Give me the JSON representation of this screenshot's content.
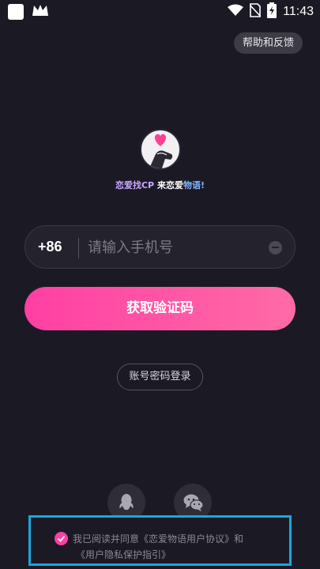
{
  "status_bar": {
    "time": "11:43",
    "icons": [
      "app-square-icon",
      "crown-icon",
      "wifi-icon",
      "no-sim-icon",
      "battery-charging-icon"
    ]
  },
  "header": {
    "help_label": "帮助和反馈"
  },
  "brand": {
    "slogan_part1": "恋爱找CP",
    "slogan_part2": "来恋",
    "slogan_part3": "爱",
    "slogan_part4": "物语!"
  },
  "login": {
    "country_code": "+86",
    "phone_placeholder": "请输入手机号",
    "get_code_label": "获取验证码",
    "account_login_label": "账号密码登录"
  },
  "social": {
    "items": [
      "qq-icon",
      "wechat-icon"
    ]
  },
  "agreement": {
    "checked": true,
    "prefix": "我已阅读并同意",
    "user_agreement": "《恋爱物语用户协议》",
    "connector": "和",
    "privacy_policy": "《用户隐私保护指引》"
  },
  "colors": {
    "background": "#1b1a24",
    "accent_pink": "#ff3fa3",
    "highlight_box": "#19a6df"
  }
}
